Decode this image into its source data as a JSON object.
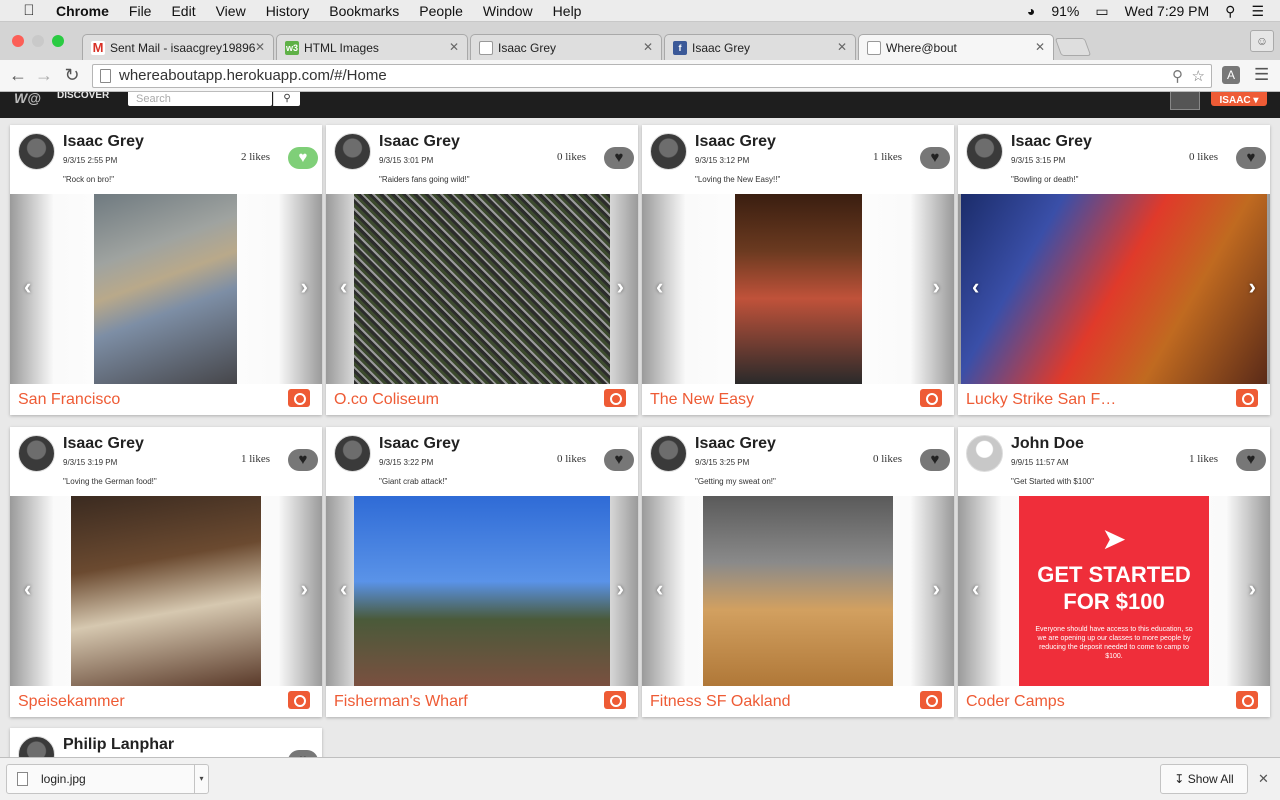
{
  "menubar": {
    "items": [
      "Chrome",
      "File",
      "Edit",
      "View",
      "History",
      "Bookmarks",
      "People",
      "Window",
      "Help"
    ],
    "battery": "91%",
    "clock": "Wed 7:29 PM"
  },
  "tabs": [
    {
      "title": "Sent Mail - isaacgrey19896",
      "favicon": "gmail-icon",
      "color": "#d93025",
      "glyph": "M"
    },
    {
      "title": "HTML Images",
      "favicon": "w3schools-icon",
      "color": "#5fb147",
      "glyph": "w3"
    },
    {
      "title": "Isaac Grey",
      "favicon": "page-icon",
      "color": "#ffffff",
      "glyph": ""
    },
    {
      "title": "Isaac Grey",
      "favicon": "facebook-icon",
      "color": "#3b5998",
      "glyph": "f"
    },
    {
      "title": "Where@bout",
      "favicon": "page-icon",
      "color": "#ffffff",
      "glyph": ""
    }
  ],
  "address": {
    "url": "whereaboutapp.herokuapp.com/#/Home"
  },
  "site": {
    "logo": "W@",
    "nav_discover": "DISCOVER",
    "search_placeholder": "Search",
    "user_button": "ISAAC ▾"
  },
  "posts": [
    {
      "name": "Isaac Grey",
      "date": "9/3/15 2:55 PM",
      "caption": "\"Rock on bro!\"",
      "likes": "2 likes",
      "liked": true,
      "location": "San Francisco",
      "photo": "guitar-player-photo"
    },
    {
      "name": "Isaac Grey",
      "date": "9/3/15 3:01 PM",
      "caption": "\"Raiders fans going wild!\"",
      "likes": "0 likes",
      "liked": false,
      "location": "O.co Coliseum",
      "photo": "stadium-crowd-photo"
    },
    {
      "name": "Isaac Grey",
      "date": "9/3/15 3:12 PM",
      "caption": "\"Loving the New Easy!!\"",
      "likes": "1 likes",
      "liked": false,
      "location": "The New Easy",
      "photo": "woman-at-bar-photo"
    },
    {
      "name": "Isaac Grey",
      "date": "9/3/15 3:15 PM",
      "caption": "\"Bowling or death!\"",
      "likes": "0 likes",
      "liked": false,
      "location": "Lucky Strike San F…",
      "photo": "bowling-alley-photo"
    },
    {
      "name": "Isaac Grey",
      "date": "9/3/15 3:19 PM",
      "caption": "\"Loving the German food!\"",
      "likes": "1 likes",
      "liked": false,
      "location": "Speisekammer",
      "photo": "dinner-table-photo"
    },
    {
      "name": "Isaac Grey",
      "date": "9/3/15 3:22 PM",
      "caption": "\"Giant crab attack!\"",
      "likes": "0 likes",
      "liked": false,
      "location": "Fisherman's Wharf",
      "photo": "crab-sculpture-photo"
    },
    {
      "name": "Isaac Grey",
      "date": "9/3/15 3:25 PM",
      "caption": "\"Getting my sweat on!\"",
      "likes": "0 likes",
      "liked": false,
      "location": "Fitness SF Oakland",
      "photo": "gym-workout-photo"
    },
    {
      "name": "John Doe",
      "date": "9/9/15 11:57 AM",
      "caption": "\"Get Started with $100\"",
      "likes": "1 likes",
      "liked": false,
      "location": "Coder Camps",
      "photo": "promo-banner"
    }
  ],
  "promo": {
    "headline1": "GET STARTED",
    "headline2": "FOR $100",
    "body": "Everyone should have access to this education, so we are opening up our classes to more people by reducing the deposit needed to come to camp to $100."
  },
  "partial_post": {
    "name": "Philip Lanphar"
  },
  "downloads": {
    "file": "login.jpg",
    "show_all": "Show All"
  },
  "colors": {
    "accent": "#ee5b35",
    "liked": "#7fcf78",
    "header": "#1e1e1e"
  }
}
